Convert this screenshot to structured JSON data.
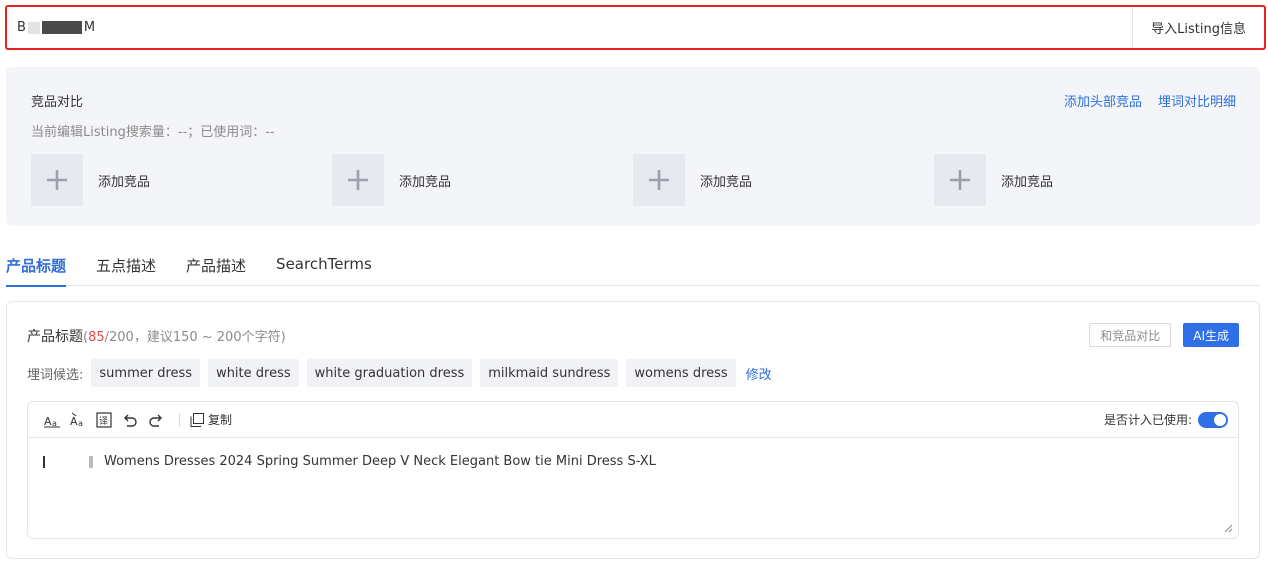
{
  "asin_input": {
    "prefix": "B",
    "suffix": "M"
  },
  "import_button": "导入Listing信息",
  "compare": {
    "title": "竞品对比",
    "links": [
      "添加头部竞品",
      "埋词对比明细"
    ],
    "stat": "当前编辑Listing搜索量：--；已使用词：--",
    "add_items": [
      "添加竞品",
      "添加竞品",
      "添加竞品",
      "添加竞品"
    ]
  },
  "tabs": [
    "产品标题",
    "五点描述",
    "产品描述",
    "SearchTerms"
  ],
  "active_tab": "产品标题",
  "title_card": {
    "heading": "产品标题",
    "count_current": "85",
    "count_rest": "/200，建议150 ~ 200个字符)",
    "count_open": "(",
    "compare_button": "和竞品对比",
    "ai_button": "AI生成",
    "keyword_label": "埋词候选:",
    "keywords": [
      "summer dress",
      "white dress",
      "white graduation dress",
      "milkmaid sundress",
      "womens dress"
    ],
    "edit_link": "修改",
    "copy_label": "复制",
    "count_used_label": "是否计入已使用:",
    "count_used_on": true,
    "text": "Womens Dresses 2024 Spring Summer Deep V Neck Elegant Bow tie Mini Dress S-XL"
  },
  "colors": {
    "accent": "#2f6fdb",
    "highlight_border": "#e5231f",
    "count_red": "#e04a4a"
  }
}
